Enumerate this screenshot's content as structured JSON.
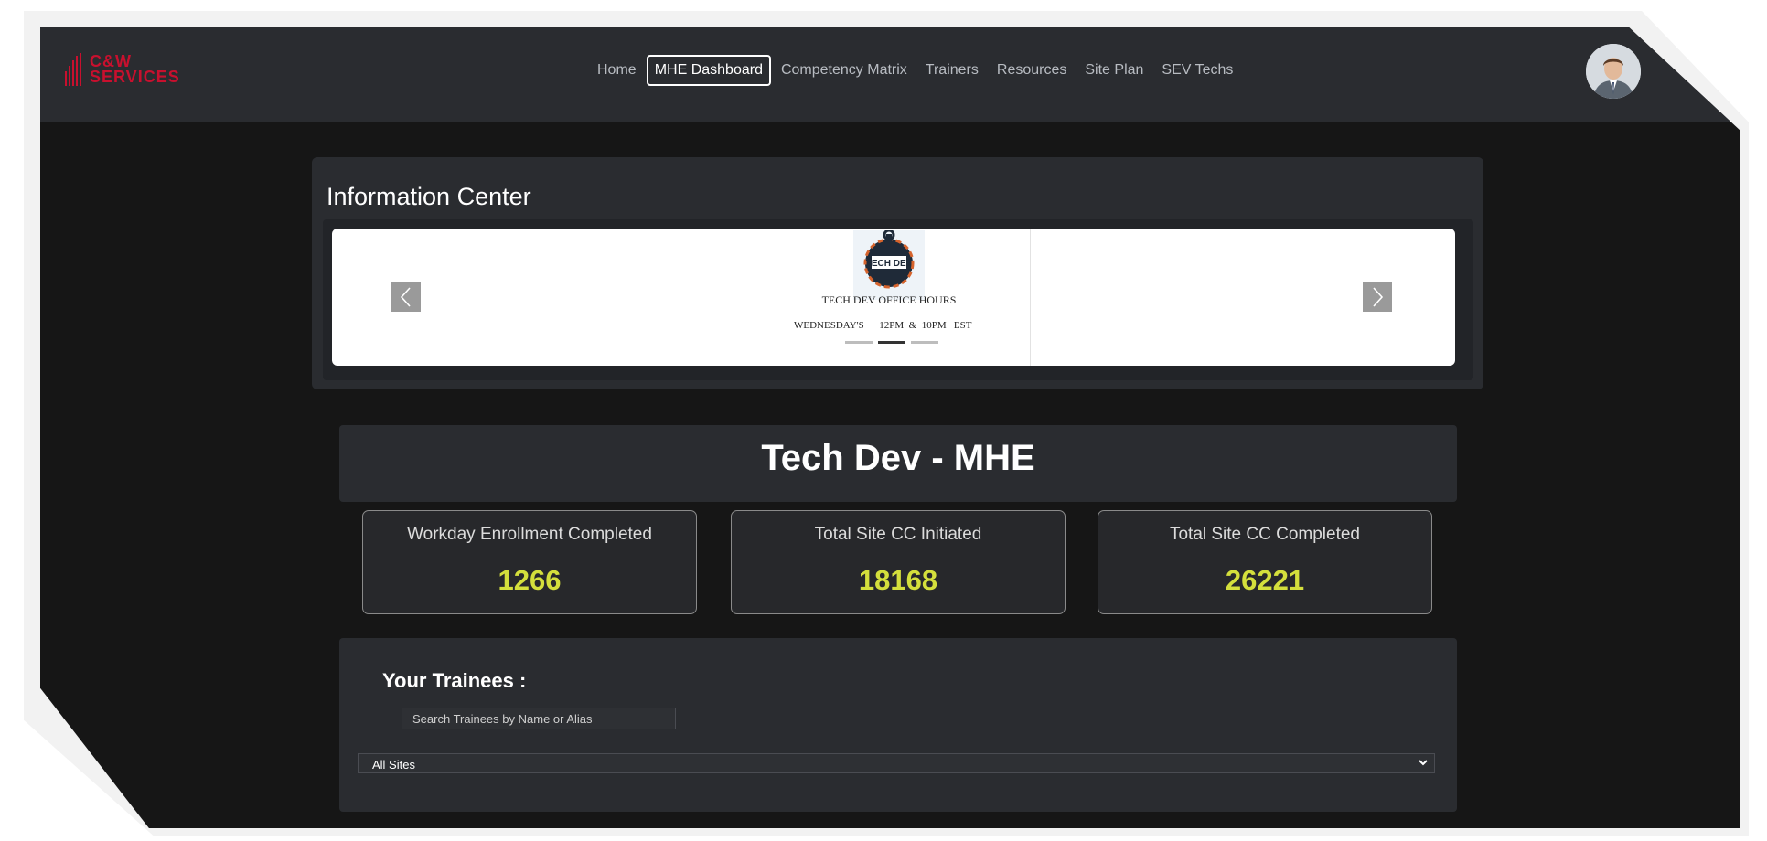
{
  "brand": {
    "line1": "C&W",
    "line2": "SERVICES",
    "icon": "cw-bars-logo-icon",
    "color": "#c8102e"
  },
  "nav": {
    "items": [
      {
        "label": "Home",
        "active": false
      },
      {
        "label": "MHE Dashboard",
        "active": true
      },
      {
        "label": "Competency Matrix",
        "active": false
      },
      {
        "label": "Trainers",
        "active": false
      },
      {
        "label": "Resources",
        "active": false
      },
      {
        "label": "Site Plan",
        "active": false
      },
      {
        "label": "SEV Techs",
        "active": false
      }
    ]
  },
  "user": {
    "avatar_icon": "user-avatar"
  },
  "info_center": {
    "title": "Information Center",
    "slide": {
      "logo_text": "TECH DEV",
      "heading": "TECH DEV OFFICE HOURS",
      "hours_day": "WEDNESDAY'S",
      "hours_times": "12PM  &  10PM   EST"
    },
    "indicators": [
      false,
      true,
      false
    ],
    "prev_icon": "chevron-left-icon",
    "next_icon": "chevron-right-icon"
  },
  "dashboard": {
    "title": "Tech Dev - MHE",
    "stats": [
      {
        "label": "Workday Enrollment Completed",
        "value": "1266"
      },
      {
        "label": "Total Site CC Initiated",
        "value": "18168"
      },
      {
        "label": "Total Site CC Completed",
        "value": "26221"
      }
    ],
    "accent": "#d4df3c"
  },
  "trainees": {
    "title": "Your Trainees :",
    "search_placeholder": "Search Trainees by Name or Alias",
    "site_selected": "All Sites"
  }
}
